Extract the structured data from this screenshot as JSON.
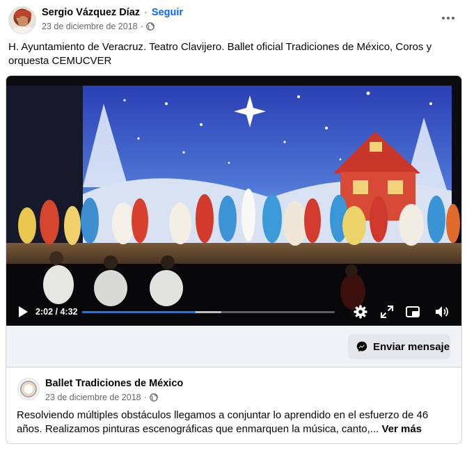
{
  "post": {
    "author": "Sergio Vázquez Díaz",
    "separator": "·",
    "follow_label": "Seguir",
    "date": "23 de diciembre de 2018",
    "date_separator": "·",
    "privacy_icon": "globe-icon",
    "more_icon": "more-options-icon",
    "caption": "H. Ayuntamiento de Veracruz. Teatro Clavijero. Ballet oficial Tradiciones de México, Coros y orquesta CEMUCVER"
  },
  "video": {
    "current_time": "2:02",
    "time_separator": " / ",
    "duration": "4:32",
    "progress_fraction": 0.45,
    "buffered_fraction": 0.55,
    "progress_color": "#1877f2",
    "icons": [
      "play-icon",
      "settings-icon",
      "fullscreen-icon",
      "picture-in-picture-icon",
      "volume-icon"
    ]
  },
  "cta": {
    "button_label": "Enviar mensaje",
    "icon": "messenger-icon"
  },
  "shared": {
    "page_name": "Ballet Tradiciones de México",
    "date": "23 de diciembre de 2018",
    "date_separator": "·",
    "privacy_icon": "globe-icon",
    "text": "Resolviendo múltiples obstáculos llegamos a conjuntar lo aprendido en el esfuerzo de 46 años. Realizamos pinturas escenográficas que enmarquen la música, canto,...",
    "see_more": "Ver más"
  },
  "colors": {
    "link_blue": "#0866ff",
    "secondary_text": "#65676b",
    "cta_bar": "#f0f2f5"
  }
}
